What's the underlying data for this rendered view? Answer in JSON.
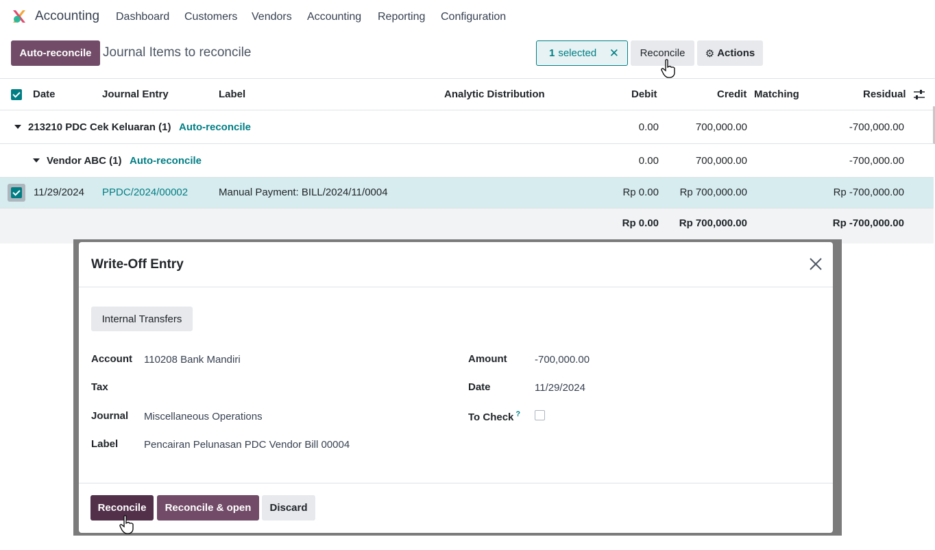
{
  "app": {
    "name": "Accounting",
    "nav": [
      "Dashboard",
      "Customers",
      "Vendors",
      "Accounting",
      "Reporting",
      "Configuration"
    ]
  },
  "control_panel": {
    "auto_reconcile_label": "Auto-reconcile",
    "breadcrumb": "Journal Items to reconcile",
    "selected_count": "1",
    "selected_text": "selected",
    "reconcile_label": "Reconcile",
    "actions_label": "Actions"
  },
  "table": {
    "columns": [
      "Date",
      "Journal Entry",
      "Label",
      "Analytic Distribution",
      "Debit",
      "Credit",
      "Matching",
      "Residual"
    ],
    "group1": {
      "label": "213210 PDC Cek Keluaran (1)",
      "action": "Auto-reconcile",
      "debit": "0.00",
      "credit": "700,000.00",
      "residual": "-700,000.00"
    },
    "group2": {
      "label": "Vendor ABC (1)",
      "action": "Auto-reconcile",
      "debit": "0.00",
      "credit": "700,000.00",
      "residual": "-700,000.00"
    },
    "row": {
      "date": "11/29/2024",
      "entry": "PPDC/2024/00002",
      "label": "Manual Payment: BILL/2024/11/0004",
      "debit": "Rp 0.00",
      "credit": "Rp 700,000.00",
      "residual": "Rp -700,000.00"
    },
    "totals": {
      "debit": "Rp 0.00",
      "credit": "Rp 700,000.00",
      "residual": "Rp -700,000.00"
    }
  },
  "modal": {
    "title": "Write-Off Entry",
    "preset_button": "Internal Transfers",
    "fields": {
      "account_label": "Account",
      "account_value": "110208 Bank Mandiri",
      "tax_label": "Tax",
      "journal_label": "Journal",
      "journal_value": "Miscellaneous Operations",
      "label_label": "Label",
      "label_value": "Pencairan Pelunasan PDC Vendor Bill 00004",
      "amount_label": "Amount",
      "amount_value": "-700,000.00",
      "date_label": "Date",
      "date_value": "11/29/2024",
      "to_check_label": "To Check",
      "to_check_help": "?"
    },
    "footer": {
      "reconcile": "Reconcile",
      "reconcile_open": "Reconcile & open",
      "discard": "Discard"
    }
  },
  "colors": {
    "primary": "#714b67",
    "teal": "#017e84",
    "selected_row": "#d7ecef"
  }
}
